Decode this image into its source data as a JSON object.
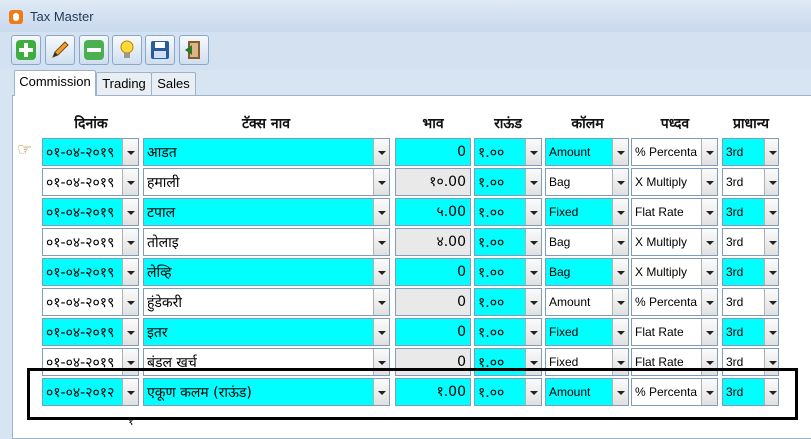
{
  "window": {
    "title": "Tax Master"
  },
  "toolbar": [
    {
      "icon": "add-icon",
      "color": "#3fae3f"
    },
    {
      "icon": "edit-icon",
      "color": "#f0a030"
    },
    {
      "icon": "delete-icon",
      "color": "#4caf50"
    },
    {
      "icon": "bulb-icon",
      "color": "#ffd93a"
    },
    {
      "icon": "save-icon",
      "color": "#2a5a9a"
    },
    {
      "icon": "exit-icon",
      "color": "#8b5a2b"
    }
  ],
  "tabs": [
    {
      "label": "Commission",
      "active": true
    },
    {
      "label": "Trading",
      "active": false
    },
    {
      "label": "Sales",
      "active": false
    }
  ],
  "columns": [
    "दिनांक",
    "टॅक्स नाव",
    "भाव",
    "राऊंड",
    "कॉलम",
    "पध्दव",
    "प्राधान्य"
  ],
  "rows": [
    {
      "date": "०१-०४-२०१९",
      "tax": "आडत",
      "rate": "0",
      "round": "१.००",
      "column": "Amount",
      "method": "% Percenta",
      "priority": "3rd",
      "hl": true,
      "pointer": true
    },
    {
      "date": "०१-०४-२०१९",
      "tax": "हमाली",
      "rate": "१०.00",
      "round": "१.००",
      "column": "Bag",
      "method": "X Multiply",
      "priority": "3rd",
      "hl": false
    },
    {
      "date": "०१-०४-२०१९",
      "tax": "टपाल",
      "rate": "५.00",
      "round": "१.००",
      "column": "Fixed",
      "method": "Flat Rate",
      "priority": "3rd",
      "hl": true
    },
    {
      "date": "०१-०४-२०१९",
      "tax": "तोलाइ",
      "rate": "४.00",
      "round": "१.००",
      "column": "Bag",
      "method": "X Multiply",
      "priority": "3rd",
      "hl": false
    },
    {
      "date": "०१-०४-२०१९",
      "tax": "लेव्हि",
      "rate": "0",
      "round": "१.००",
      "column": "Bag",
      "method": "X Multiply",
      "priority": "3rd",
      "hl": true
    },
    {
      "date": "०१-०४-२०१९",
      "tax": "हुंडेकरी",
      "rate": "0",
      "round": "१.००",
      "column": "Amount",
      "method": "% Percenta",
      "priority": "3rd",
      "hl": false
    },
    {
      "date": "०१-०४-२०१९",
      "tax": "इतर",
      "rate": "0",
      "round": "१.००",
      "column": "Fixed",
      "method": "Flat Rate",
      "priority": "3rd",
      "hl": true
    },
    {
      "date": "०१-०४-२०१९",
      "tax": "बंडल खर्च",
      "rate": "0",
      "round": "१.००",
      "column": "Fixed",
      "method": "Flat Rate",
      "priority": "3rd",
      "hl": false
    },
    {
      "date": "०१-०४-२०१२",
      "tax": "एकूण कलम (राऊंड)",
      "rate": "१.00",
      "round": "१.००",
      "column": "Amount",
      "method": "% Percenta",
      "priority": "3rd",
      "hl": true
    }
  ],
  "footnote": "१"
}
